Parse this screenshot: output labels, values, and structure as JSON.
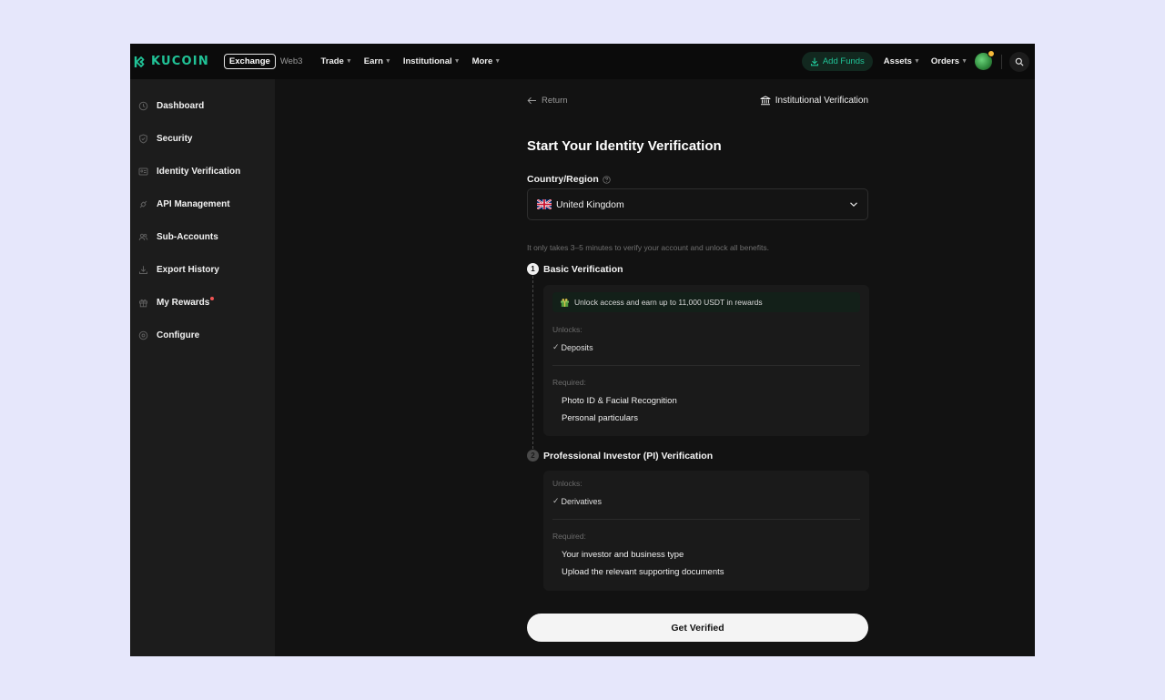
{
  "nav": {
    "brand": "KUCOIN",
    "segment_active": "Exchange",
    "segment_other": "Web3",
    "menu": [
      {
        "label": "Trade"
      },
      {
        "label": "Earn"
      },
      {
        "label": "Institutional"
      },
      {
        "label": "More"
      }
    ],
    "add_funds": "Add Funds",
    "assets": "Assets",
    "orders": "Orders",
    "accent_color": "#21c397"
  },
  "sidebar": {
    "items": [
      {
        "label": "Dashboard",
        "icon": "clock-icon"
      },
      {
        "label": "Security",
        "icon": "shield-icon"
      },
      {
        "label": "Identity Verification",
        "icon": "id-card-icon"
      },
      {
        "label": "API Management",
        "icon": "api-link-icon"
      },
      {
        "label": "Sub-Accounts",
        "icon": "users-icon"
      },
      {
        "label": "Export History",
        "icon": "download-icon"
      },
      {
        "label": "My Rewards",
        "icon": "gift-icon"
      },
      {
        "label": "Configure",
        "icon": "gear-icon"
      }
    ]
  },
  "main": {
    "return_label": "Return",
    "institutional_label": "Institutional Verification",
    "title": "Start Your Identity Verification",
    "country_label": "Country/Region",
    "country_value": "United Kingdom",
    "intro": "It only takes 3–5 minutes to verify your account and unlock all benefits.",
    "basic": {
      "number": "1",
      "title": "Basic Verification",
      "reward": "Unlock access and earn up to 11,000 USDT in rewards",
      "unlocks_label": "Unlocks:",
      "unlocks": [
        "Deposits"
      ],
      "required_label": "Required:",
      "required": [
        "Photo ID & Facial Recognition",
        "Personal particulars"
      ]
    },
    "pro": {
      "number": "2",
      "title": "Professional Investor (PI) Verification",
      "unlocks_label": "Unlocks:",
      "unlocks": [
        "Derivatives"
      ],
      "required_label": "Required:",
      "required": [
        "Your investor and business type",
        "Upload the relevant supporting documents"
      ]
    },
    "cta": "Get Verified"
  }
}
